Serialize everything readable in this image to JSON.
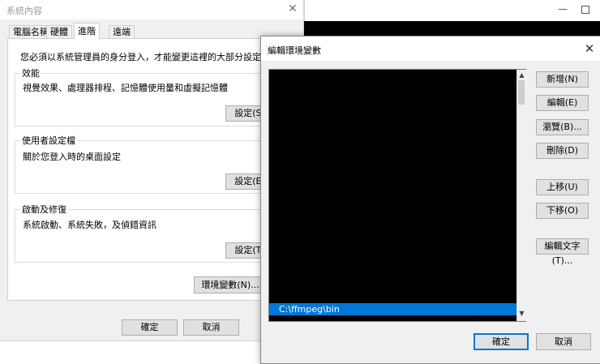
{
  "system_properties": {
    "title": "系統內容",
    "tabs": [
      "電腦名稱",
      "硬體",
      "進階",
      "遠端"
    ],
    "active_tab_index": 2,
    "admin_notice": "您必須以系統管理員的身分登入，才能變更這裡的大部分設定。",
    "performance": {
      "legend": "效能",
      "description": "視覺效果、處理器排程、記憶體使用量和虛擬記憶體",
      "button": "設定(S)"
    },
    "user_profiles": {
      "legend": "使用者設定檔",
      "description": "關於您登入時的桌面設定",
      "button": "設定(E)"
    },
    "startup_recovery": {
      "legend": "啟動及修復",
      "description": "系統啟動、系統失敗，及偵錯資訊",
      "button": "設定(T)"
    },
    "env_vars_button": "環境變數(N)...",
    "ok_button": "確定",
    "cancel_button": "取消"
  },
  "dark_window": {
    "minimize_glyph": "—"
  },
  "edit_env_dialog": {
    "title": "編輯環境變數",
    "close_glyph": "✕",
    "selected_entry": "C:\\ffmpeg\\bin",
    "buttons": {
      "new": "新增(N)",
      "edit": "編輯(E)",
      "browse": "瀏覽(B)...",
      "delete": "刪除(D)",
      "move_up": "上移(U)",
      "move_down": "下移(O)",
      "edit_text": "編輯文字(T)..."
    },
    "ok_button": "確定",
    "cancel_button": "取消"
  },
  "colors": {
    "accent": "#0078d7",
    "dialog_bg": "#f0f0f0",
    "list_bg": "#000000"
  }
}
